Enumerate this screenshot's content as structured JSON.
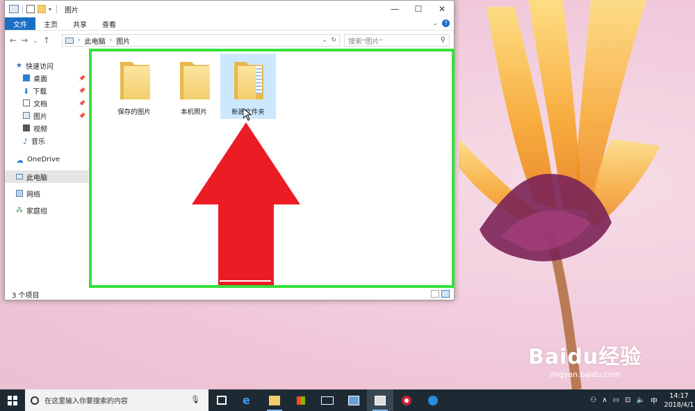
{
  "window": {
    "title": "图片",
    "controls": {
      "minimize": "—",
      "maximize": "☐",
      "close": "✕"
    }
  },
  "ribbon": {
    "tabs": [
      "文件",
      "主页",
      "共享",
      "查看"
    ]
  },
  "address": {
    "segments": [
      "此电脑",
      "图片"
    ],
    "search_placeholder": "搜索\"图片\""
  },
  "nav_pane": {
    "quick_access": "快速访问",
    "quick_items": [
      "桌面",
      "下载",
      "文档",
      "图片",
      "视频",
      "音乐"
    ],
    "onedrive": "OneDrive",
    "this_pc": "此电脑",
    "network": "网络",
    "homegroup": "家庭组"
  },
  "folders": [
    {
      "name": "保存的图片"
    },
    {
      "name": "本机照片"
    },
    {
      "name": "新建文件夹"
    }
  ],
  "status": {
    "item_count": "3 个项目"
  },
  "taskbar": {
    "search_placeholder": "在这里输入你要搜索的内容",
    "ime": "中",
    "time": "14:17",
    "date": "2018/4/1"
  },
  "watermark": {
    "brand": "Baidu经验",
    "url": "jingyan.baidu.com"
  },
  "colors": {
    "accent": "#1a6fc4",
    "annotation_box": "#35e13a",
    "annotation_arrow": "#ec1c24",
    "taskbar": "#1e2a33"
  }
}
